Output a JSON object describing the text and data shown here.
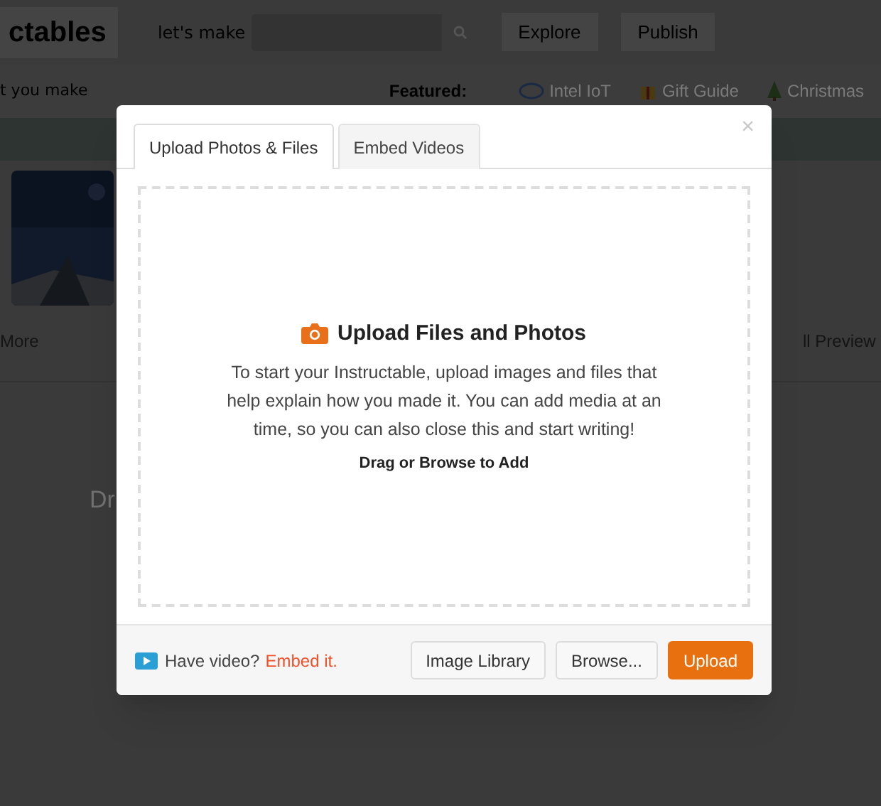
{
  "background_page": {
    "logo": "ctables",
    "search_label": "let's make",
    "nav": [
      "Explore",
      "Publish"
    ],
    "tagline": "t you make",
    "featured_label": "Featured:",
    "featured": [
      {
        "label": "Intel IoT"
      },
      {
        "label": "Gift Guide"
      },
      {
        "label": "Christmas"
      }
    ],
    "more_menu": "More",
    "preview_button": "ll Preview",
    "drop_hint": "Dr"
  },
  "modal": {
    "tabs": [
      {
        "label": "Upload Photos & Files",
        "selected": true
      },
      {
        "label": "Embed Videos",
        "selected": false
      }
    ],
    "close": "×",
    "dropzone": {
      "title": "Upload Files and Photos",
      "description": "To start your Instructable, upload images and files that help explain how you made it. You can add media at an time, so you can also close this and start writing!",
      "hint": "Drag or Browse to Add"
    },
    "footer": {
      "video_prompt": "Have video?",
      "embed_link": "Embed it.",
      "buttons": [
        {
          "label": "Image Library",
          "kind": "default"
        },
        {
          "label": "Browse...",
          "kind": "default"
        },
        {
          "label": "Upload",
          "kind": "primary"
        }
      ]
    }
  }
}
